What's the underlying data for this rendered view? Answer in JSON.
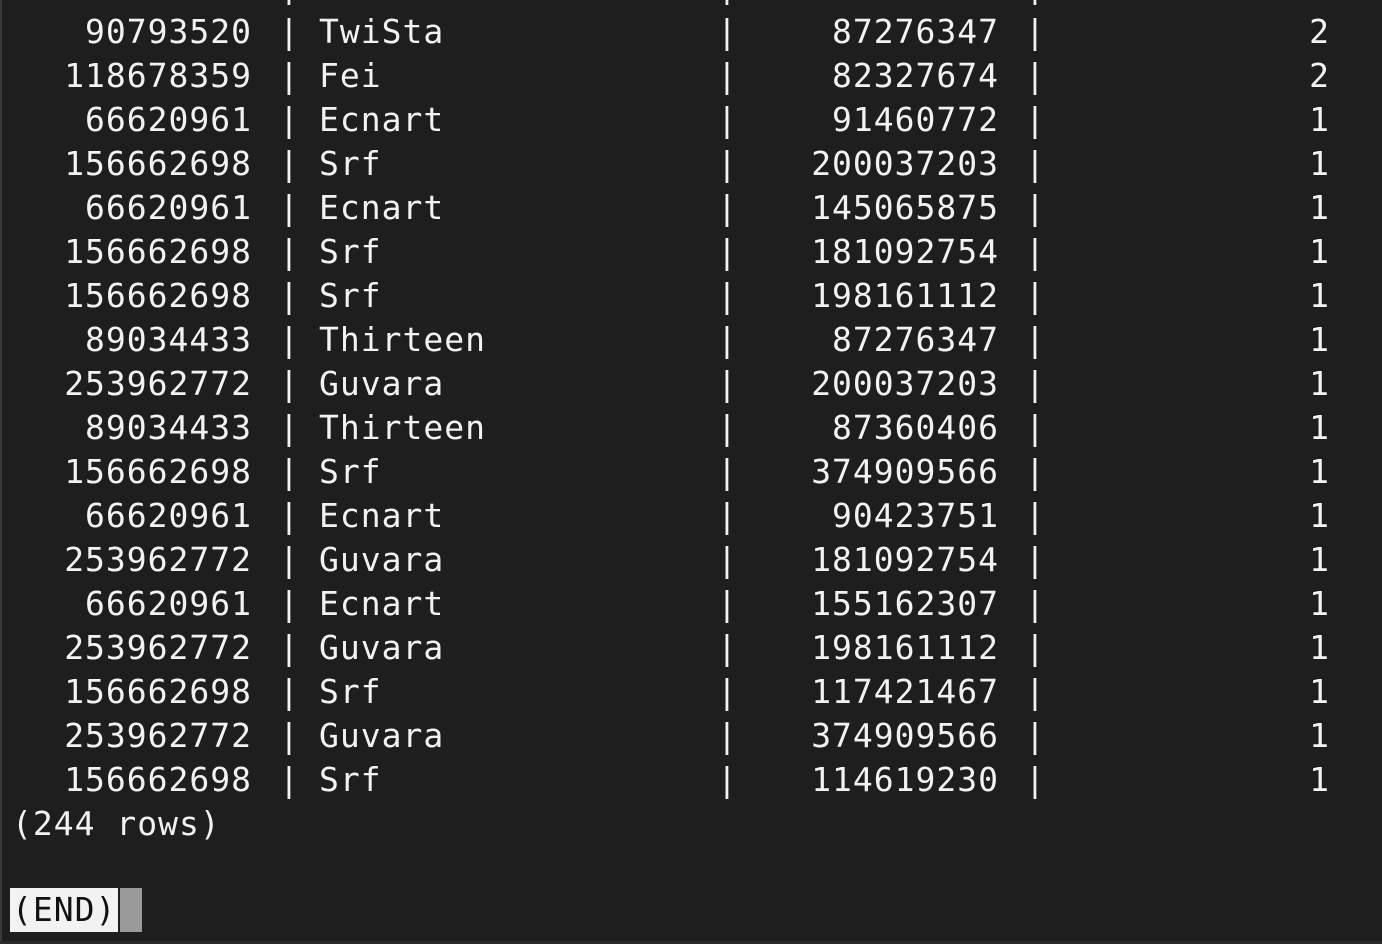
{
  "partial_top_row": {
    "id": "",
    "name": "",
    "val": "",
    "count": ""
  },
  "rows": [
    {
      "id": "90793520",
      "name": "TwiSta",
      "val": "87276347",
      "count": "2"
    },
    {
      "id": "118678359",
      "name": "Fei",
      "val": "82327674",
      "count": "2"
    },
    {
      "id": "66620961",
      "name": "Ecnart",
      "val": "91460772",
      "count": "1"
    },
    {
      "id": "156662698",
      "name": "Srf",
      "val": "200037203",
      "count": "1"
    },
    {
      "id": "66620961",
      "name": "Ecnart",
      "val": "145065875",
      "count": "1"
    },
    {
      "id": "156662698",
      "name": "Srf",
      "val": "181092754",
      "count": "1"
    },
    {
      "id": "156662698",
      "name": "Srf",
      "val": "198161112",
      "count": "1"
    },
    {
      "id": "89034433",
      "name": "Thirteen",
      "val": "87276347",
      "count": "1"
    },
    {
      "id": "253962772",
      "name": "Guvara",
      "val": "200037203",
      "count": "1"
    },
    {
      "id": "89034433",
      "name": "Thirteen",
      "val": "87360406",
      "count": "1"
    },
    {
      "id": "156662698",
      "name": "Srf",
      "val": "374909566",
      "count": "1"
    },
    {
      "id": "66620961",
      "name": "Ecnart",
      "val": "90423751",
      "count": "1"
    },
    {
      "id": "253962772",
      "name": "Guvara",
      "val": "181092754",
      "count": "1"
    },
    {
      "id": "66620961",
      "name": "Ecnart",
      "val": "155162307",
      "count": "1"
    },
    {
      "id": "253962772",
      "name": "Guvara",
      "val": "198161112",
      "count": "1"
    },
    {
      "id": "156662698",
      "name": "Srf",
      "val": "117421467",
      "count": "1"
    },
    {
      "id": "253962772",
      "name": "Guvara",
      "val": "374909566",
      "count": "1"
    },
    {
      "id": "156662698",
      "name": "Srf",
      "val": "114619230",
      "count": "1"
    }
  ],
  "separator": "|",
  "footer": {
    "row_count_text": "(244 rows)"
  },
  "pager": {
    "end_text": "(END)"
  },
  "colors": {
    "background": "#1e1e1e",
    "text": "#f2f2f2",
    "prompt_bg": "#f2f2f2",
    "prompt_fg": "#111111",
    "cursor": "#9a9a9a"
  }
}
